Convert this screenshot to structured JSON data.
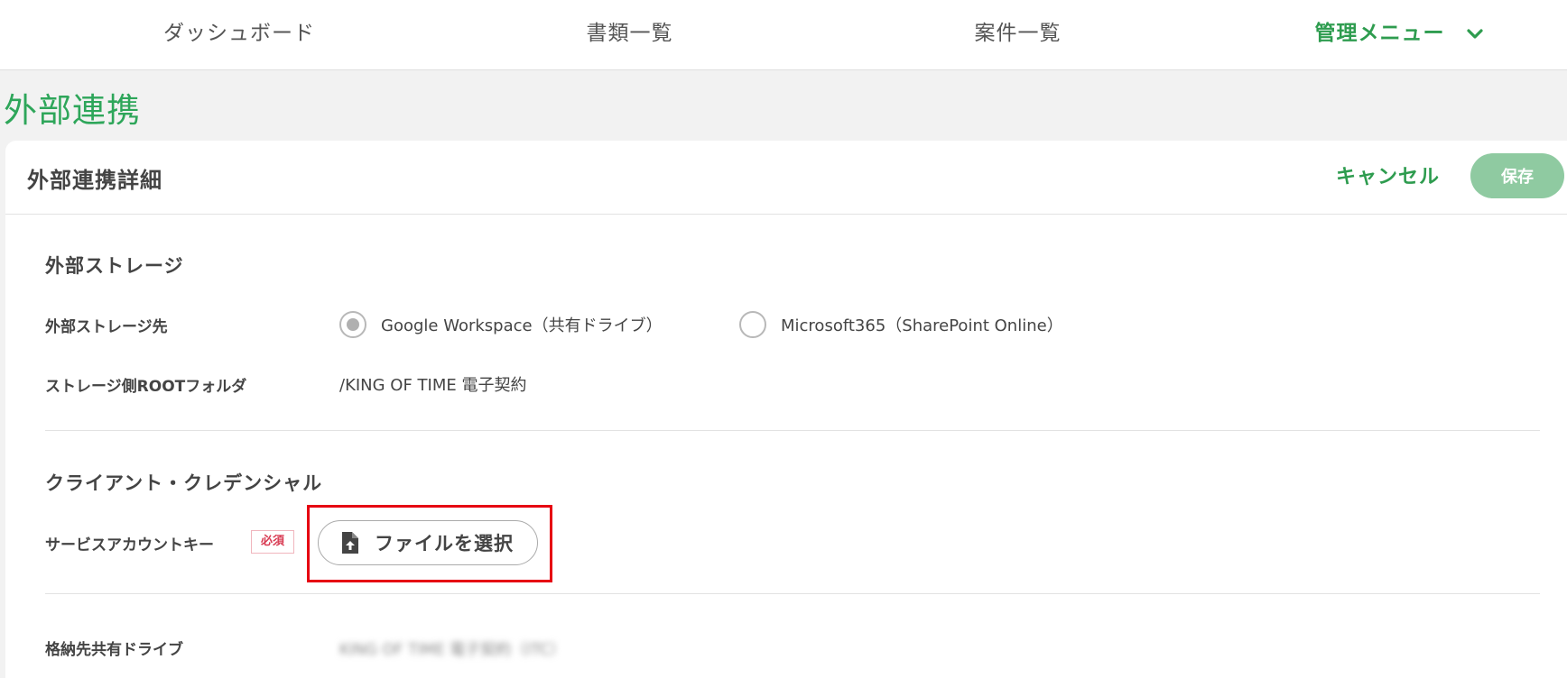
{
  "nav": {
    "dashboard": "ダッシュボード",
    "documents": "書類一覧",
    "cases": "案件一覧",
    "admin": "管理メニュー",
    "admin_icon": "chevron-down-icon"
  },
  "page": {
    "title": "外部連携"
  },
  "card": {
    "title": "外部連携詳細",
    "cancel_label": "キャンセル",
    "save_label": "保存"
  },
  "storage": {
    "section_title": "外部ストレージ",
    "destination_label": "外部ストレージ先",
    "options": [
      {
        "label": "Google Workspace（共有ドライブ）",
        "selected": true
      },
      {
        "label": "Microsoft365（SharePoint Online）",
        "selected": false
      }
    ],
    "root_label": "ストレージ側ROOTフォルダ",
    "root_value": "/KING OF TIME 電子契約"
  },
  "credential": {
    "section_title": "クライアント・クレデンシャル",
    "service_key_label": "サービスアカウントキー",
    "required_badge": "必須",
    "file_button_label": "ファイルを選択",
    "file_icon": "file-upload-icon"
  },
  "drive": {
    "label": "格納先共有ドライブ",
    "value": "KING OF TIME 電子契約（ITC）"
  },
  "colors": {
    "accent": "#2e9c4f",
    "title": "#2ea65a",
    "save_button": "#8fcaa1",
    "highlight": "#e60012",
    "required": "#d83a52"
  }
}
